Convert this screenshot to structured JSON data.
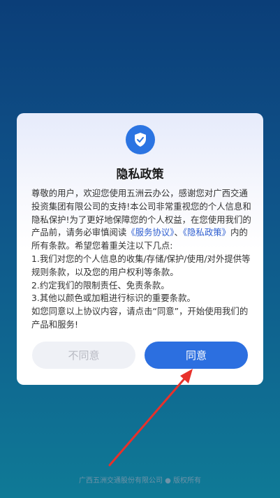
{
  "dialog": {
    "title": "隐私政策",
    "body": {
      "intro_a": "尊敬的用户，欢迎您使用五洲云办公，感谢您对广西交通投资集团有限公司的支持!本公司非常重视您的个人信息和隐私保护!为了更好地保障您的个人权益，在您使用我们的产品前，请务必审慎阅读",
      "link_service": "《服务协议》",
      "separator": "、",
      "link_privacy": "《隐私政策》",
      "intro_b": "内的所有条款。希望您着重关注以下几点:",
      "point_1": "1.我们对您的个人信息的收集/存储/保护/使用/对外提供等规则条款，以及您的用户权利等条款。",
      "point_2": "2.约定我们的限制责任、免责条款。",
      "point_3": "3.其他以颜色或加粗进行标识的重要条款。",
      "closing": "如您同意以上协议内容，请点击“同意”，开始使用我们的产品和服务!"
    },
    "buttons": {
      "disagree": "不同意",
      "agree": "同意"
    }
  },
  "footer": {
    "copyright": "广西五洲交通股份有限公司 ● 版权所有"
  },
  "colors": {
    "accent": "#2c6fe0",
    "link": "#2f5fd0",
    "annotation_arrow": "#e8312b"
  },
  "icons": {
    "header": "shield-check-icon"
  }
}
